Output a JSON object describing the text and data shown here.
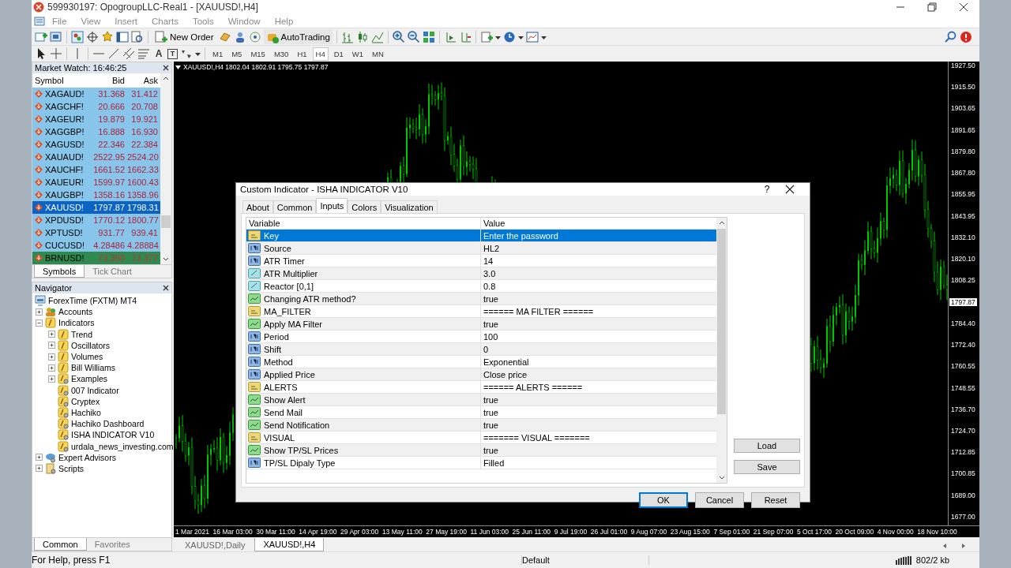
{
  "window": {
    "title": "599930197: OpogroupLLC-Real1 - [XAUUSD!,H4]"
  },
  "menu": [
    "File",
    "View",
    "Insert",
    "Charts",
    "Tools",
    "Window",
    "Help"
  ],
  "toolbar": {
    "new_order": "New Order",
    "autotrading": "AutoTrading",
    "text_tool": "A",
    "label_tool": "T"
  },
  "periods": [
    {
      "label": "M1",
      "selected": false
    },
    {
      "label": "M5",
      "selected": false
    },
    {
      "label": "M15",
      "selected": false
    },
    {
      "label": "M30",
      "selected": false
    },
    {
      "label": "H1",
      "selected": false
    },
    {
      "label": "H4",
      "selected": true
    },
    {
      "label": "D1",
      "selected": false
    },
    {
      "label": "W1",
      "selected": false
    },
    {
      "label": "MN",
      "selected": false
    }
  ],
  "market_watch": {
    "title": "Market Watch: 16:46:25",
    "columns": [
      "Symbol",
      "Bid",
      "Ask"
    ],
    "rows": [
      {
        "symbol": "XAGAUD!",
        "bid": "31.368",
        "ask": "31.412",
        "selected": false,
        "alert": false
      },
      {
        "symbol": "XAGCHF!",
        "bid": "20.666",
        "ask": "20.708",
        "selected": false,
        "alert": false
      },
      {
        "symbol": "XAGEUR!",
        "bid": "19.879",
        "ask": "19.921",
        "selected": false,
        "alert": false
      },
      {
        "symbol": "XAGGBP!",
        "bid": "16.888",
        "ask": "16.930",
        "selected": false,
        "alert": false
      },
      {
        "symbol": "XAGUSD!",
        "bid": "22.346",
        "ask": "22.384",
        "selected": false,
        "alert": false
      },
      {
        "symbol": "XAUAUD!",
        "bid": "2522.95",
        "ask": "2524.20",
        "selected": false,
        "alert": false
      },
      {
        "symbol": "XAUCHF!",
        "bid": "1661.52",
        "ask": "1662.33",
        "selected": false,
        "alert": false
      },
      {
        "symbol": "XAUEUR!",
        "bid": "1599.97",
        "ask": "1600.43",
        "selected": false,
        "alert": false
      },
      {
        "symbol": "XAUGBP!",
        "bid": "1358.16",
        "ask": "1358.96",
        "selected": false,
        "alert": false
      },
      {
        "symbol": "XAUUSD!",
        "bid": "1797.87",
        "ask": "1798.31",
        "selected": true,
        "alert": false
      },
      {
        "symbol": "XPDUSD!",
        "bid": "1770.12",
        "ask": "1800.77",
        "selected": false,
        "alert": false
      },
      {
        "symbol": "XPTUSD!",
        "bid": "931.77",
        "ask": "939.41",
        "selected": false,
        "alert": false
      },
      {
        "symbol": "CUCUSD!",
        "bid": "4.28486",
        "ask": "4.28884",
        "selected": false,
        "alert": false
      },
      {
        "symbol": "BRNUSD!",
        "bid": "73.350",
        "ask": "73.377",
        "selected": false,
        "alert": true
      }
    ],
    "tabs": [
      {
        "label": "Symbols",
        "selected": true
      },
      {
        "label": "Tick Chart",
        "selected": false
      }
    ]
  },
  "navigator": {
    "title": "Navigator",
    "tree": [
      {
        "label": "ForexTime (FXTM) MT4",
        "kind": "terminal",
        "children": [
          {
            "label": "Accounts",
            "kind": "accounts",
            "expanded": false
          },
          {
            "label": "Indicators",
            "kind": "folder",
            "expanded": true,
            "children": [
              {
                "label": "Trend",
                "kind": "folder",
                "expanded": false
              },
              {
                "label": "Oscillators",
                "kind": "folder",
                "expanded": false
              },
              {
                "label": "Volumes",
                "kind": "folder",
                "expanded": false
              },
              {
                "label": "Bill Williams",
                "kind": "folder",
                "expanded": false
              },
              {
                "label": "Examples",
                "kind": "custom",
                "expanded": false
              },
              {
                "label": "007 Indicator",
                "kind": "custom"
              },
              {
                "label": "Cryptex",
                "kind": "custom"
              },
              {
                "label": "Hachiko",
                "kind": "custom"
              },
              {
                "label": "Hachiko Dashboard",
                "kind": "custom"
              },
              {
                "label": "ISHA INDICATOR V10",
                "kind": "custom"
              },
              {
                "label": "urdala_news_investing.com",
                "kind": "custom"
              }
            ]
          },
          {
            "label": "Expert Advisors",
            "kind": "experts",
            "expanded": false
          },
          {
            "label": "Scripts",
            "kind": "scripts",
            "expanded": false
          }
        ]
      }
    ],
    "tabs": [
      {
        "label": "Common",
        "selected": true
      },
      {
        "label": "Favorites",
        "selected": false
      }
    ]
  },
  "chart": {
    "legend": "XAUUSD!,H4 1802.04 1802.91 1795.75 1797.87",
    "price_labels": [
      "1927.50",
      "1915.50",
      "1903.65",
      "1891.65",
      "1879.80",
      "1867.80",
      "1855.95",
      "1843.95",
      "1832.10",
      "1820.10",
      "1808.25",
      "1784.40",
      "1772.40",
      "1760.55",
      "1748.55",
      "1736.70",
      "1724.70",
      "1712.85",
      "1700.85",
      "1689.00",
      "1677.00"
    ],
    "current_price": "1797.87",
    "time_labels": [
      "1 Mar 2021",
      "16 Mar 03:00",
      "30 Mar 11:00",
      "14 Apr 19:00",
      "29 Apr 03:00",
      "13 May 11:00",
      "27 May 19:00",
      "11 Jun 03:00",
      "25 Jun 11:00",
      "9 Jul 19:00",
      "26 Jul 01:00",
      "9 Aug 07:00",
      "23 Aug 15:00",
      "7 Sep 01:00",
      "21 Sep 07:00",
      "5 Oct 17:00",
      "20 Oct 09:00",
      "4 Nov 00:00",
      "18 Nov 10:00"
    ],
    "tabs": [
      {
        "label": "XAUUSD!,Daily",
        "selected": false
      },
      {
        "label": "XAUUSD!,H4",
        "selected": true
      }
    ]
  },
  "dialog": {
    "title": "Custom Indicator - ISHA INDICATOR V10",
    "help_button": "?",
    "tabs": [
      {
        "label": "About",
        "selected": false
      },
      {
        "label": "Common",
        "selected": false
      },
      {
        "label": "Inputs",
        "selected": true
      },
      {
        "label": "Colors",
        "selected": false
      },
      {
        "label": "Visualization",
        "selected": false
      }
    ],
    "columns": [
      "Variable",
      "Value"
    ],
    "params": [
      {
        "kind": "string",
        "variable": "Key",
        "value": "Enter the password",
        "selected": true
      },
      {
        "kind": "int",
        "variable": "Source",
        "value": "HL2",
        "selected": false
      },
      {
        "kind": "int",
        "variable": "ATR Timer",
        "value": "14",
        "selected": false
      },
      {
        "kind": "double",
        "variable": "ATR Multiplier",
        "value": "3.0",
        "selected": false
      },
      {
        "kind": "double",
        "variable": "Reactor [0,1]",
        "value": "0.8",
        "selected": false
      },
      {
        "kind": "bool",
        "variable": "Changing ATR method?",
        "value": "true",
        "selected": false
      },
      {
        "kind": "string",
        "variable": "MA_FILTER",
        "value": "====== MA FILTER ======",
        "selected": false
      },
      {
        "kind": "bool",
        "variable": "Apply MA Filter",
        "value": "true",
        "selected": false
      },
      {
        "kind": "int",
        "variable": "Period",
        "value": "100",
        "selected": false
      },
      {
        "kind": "int",
        "variable": "Shift",
        "value": "0",
        "selected": false
      },
      {
        "kind": "int",
        "variable": "Method",
        "value": "Exponential",
        "selected": false
      },
      {
        "kind": "int",
        "variable": "Applied Price",
        "value": "Close price",
        "selected": false
      },
      {
        "kind": "string",
        "variable": "ALERTS",
        "value": "====== ALERTS ======",
        "selected": false
      },
      {
        "kind": "bool",
        "variable": "Show Alert",
        "value": "true",
        "selected": false
      },
      {
        "kind": "bool",
        "variable": "Send Mail",
        "value": "true",
        "selected": false
      },
      {
        "kind": "bool",
        "variable": "Send Notification",
        "value": "true",
        "selected": false
      },
      {
        "kind": "string",
        "variable": "VISUAL",
        "value": "======= VISUAL =======",
        "selected": false
      },
      {
        "kind": "bool",
        "variable": "Show TP/SL Prices",
        "value": "true",
        "selected": false
      },
      {
        "kind": "int",
        "variable": "TP/SL Dipaly Type",
        "value": "Filled",
        "selected": false
      }
    ],
    "side_buttons": [
      "Load",
      "Save"
    ],
    "buttons": [
      "OK",
      "Cancel",
      "Reset"
    ]
  },
  "status_bar": {
    "help": "For Help, press F1",
    "profile": "Default",
    "traffic": "802/2 kb"
  }
}
